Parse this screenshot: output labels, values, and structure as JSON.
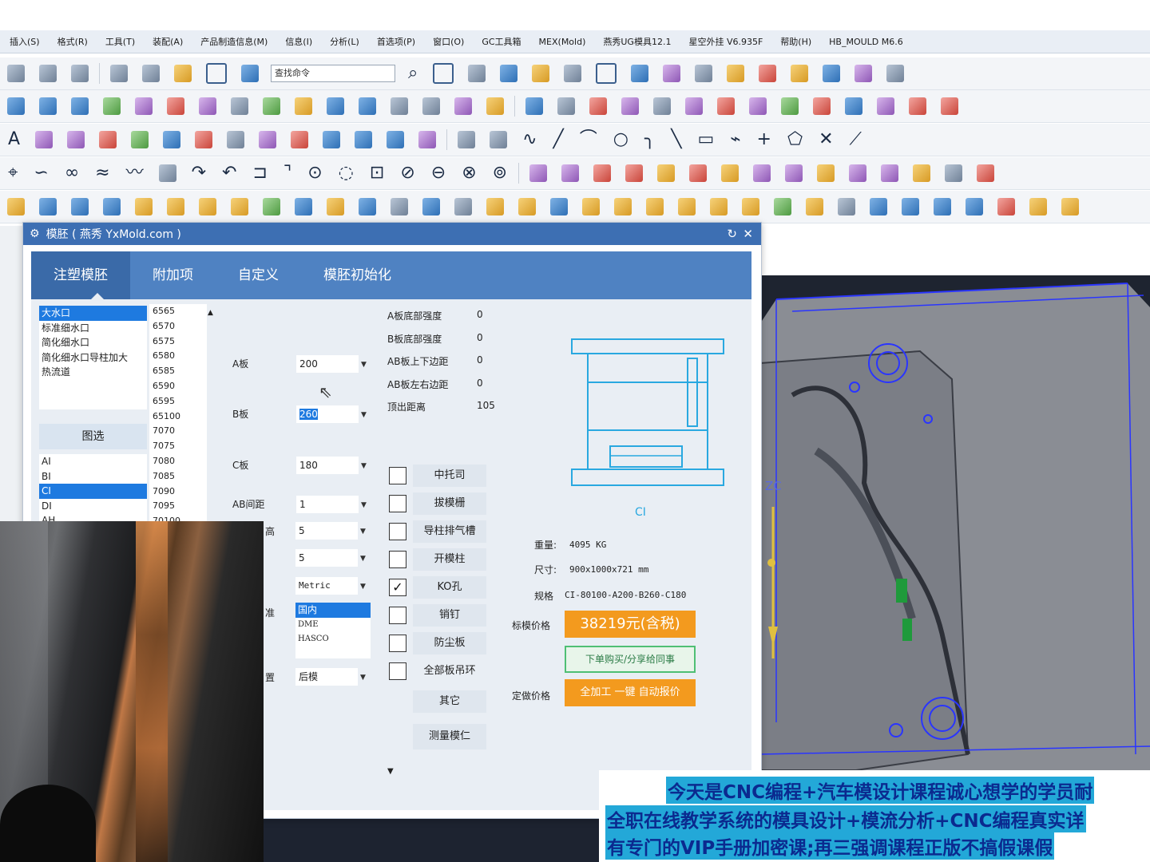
{
  "menubar": {
    "items": [
      "插入(S)",
      "格式(R)",
      "工具(T)",
      "装配(A)",
      "产品制造信息(M)",
      "信息(I)",
      "分析(L)",
      "首选项(P)",
      "窗口(O)",
      "GC工具箱",
      "MEX(Mold)",
      "燕秀UG模具12.1",
      "星空外挂 V6.935F",
      "帮助(H)",
      "HB_MOULD M6.6"
    ]
  },
  "toolbar": {
    "search_placeholder": "查找命令",
    "text_tool": "A"
  },
  "dialog": {
    "title": "模胚 ( 燕秀 YxMold.com )",
    "tabs": [
      "注塑模胚",
      "附加项",
      "自定义",
      "模胚初始化"
    ],
    "types": [
      "大水口",
      "标准细水口",
      "简化细水口",
      "简化细水口导柱加大",
      "热流道"
    ],
    "pick_button": "图选",
    "series": [
      "AI",
      "BI",
      "CI",
      "DI",
      "AH"
    ],
    "sizes": [
      "6565",
      "6570",
      "6575",
      "6580",
      "6585",
      "6590",
      "6595",
      "65100",
      "7070",
      "7075",
      "7080",
      "7085",
      "7090",
      "7095",
      "70100"
    ],
    "fields": {
      "a_plate_label": "A板",
      "a_plate_value": "200",
      "b_plate_label": "B板",
      "b_plate_value": "260",
      "c_plate_label": "C板",
      "c_plate_value": "180",
      "ab_gap_label": "AB间距",
      "ab_gap_value": "1",
      "f5_label": "高",
      "f5_value": "5",
      "f6_value": "5",
      "unit_value": "Metric",
      "standard_label": "准",
      "standard_options": [
        "国内",
        "DME",
        "HASCO"
      ],
      "position_label": "置",
      "position_value": "后模"
    },
    "params": [
      {
        "label": "A板底部强度",
        "value": "0"
      },
      {
        "label": "B板底部强度",
        "value": "0"
      },
      {
        "label": "AB板上下边距",
        "value": "0"
      },
      {
        "label": "AB板左右边距",
        "value": "0"
      },
      {
        "label": "顶出距离",
        "value": "105"
      }
    ],
    "options": [
      {
        "label": "中托司",
        "checked": false
      },
      {
        "label": "拔模栅",
        "checked": false
      },
      {
        "label": "导柱排气槽",
        "checked": false
      },
      {
        "label": "开模柱",
        "checked": false
      },
      {
        "label": "KO孔",
        "checked": true
      },
      {
        "label": "销钉",
        "checked": false
      },
      {
        "label": "防尘板",
        "checked": false
      },
      {
        "label": "全部板吊环",
        "checked": false
      }
    ],
    "other_button": "其它",
    "measure_button": "测量模仁",
    "preview_caption": "CI",
    "weight_label": "重量:",
    "weight_value": "4095 KG",
    "size_label": "尺寸:",
    "size_value": "900x1000x721 mm",
    "spec_label": "规格",
    "spec_value": "CI-80100-A200-B260-C180",
    "std_price_label": "标模价格",
    "std_price_value": "38219元(含税)",
    "order_button": "下单购买/分享给同事",
    "custom_price_label": "定做价格",
    "custom_price_button": "全加工 一键 自动报价",
    "refresh_icon": "↻",
    "close_icon": "✕"
  },
  "viewport": {
    "axis_label": "ZC"
  },
  "caption": {
    "lines": [
      "今天是CNC编程+汽车模设计课程诚心想学的学员耐",
      "全职在线教学系统的模具设计+模流分析+CNC编程真实详",
      "有专门的VIP手册加密课;再三强调课程正版不搞假课假"
    ]
  },
  "colors": {
    "accent": "#4f82c2",
    "title_bar": "#3d6fb3",
    "selection": "#1e7ae0",
    "price_orange": "#f39a1e",
    "green_border": "#4fbf74"
  }
}
